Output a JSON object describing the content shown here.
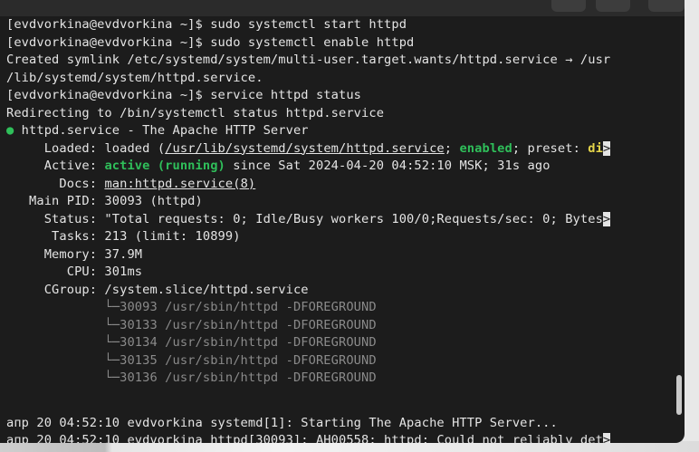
{
  "terminal": {
    "lines": [
      "[evdvorkina@evdvorkina ~]$ sudo systemctl start httpd",
      "[evdvorkina@evdvorkina ~]$ sudo systemctl enable httpd",
      "Created symlink /etc/systemd/system/multi-user.target.wants/httpd.service → /usr",
      "/lib/systemd/system/httpd.service.",
      "[evdvorkina@evdvorkina ~]$ service httpd status",
      "Redirecting to /bin/systemctl status httpd.service"
    ],
    "status": {
      "dot": "●",
      "unit_title": " httpd.service - The Apache HTTP Server",
      "loaded_label": "     Loaded: ",
      "loaded_pre": "loaded (",
      "loaded_path": "/usr/lib/systemd/system/httpd.service",
      "loaded_sep": "; ",
      "loaded_enabled": "enabled",
      "loaded_preset": "; preset: ",
      "loaded_preset_value": "di",
      "overflow_marker": ">",
      "active_label": "     Active: ",
      "active_value": "active (running)",
      "active_since": " since Sat 2024-04-20 04:52:10 MSK; 31s ago",
      "docs_label": "       Docs: ",
      "docs_value": "man:httpd.service(8)",
      "mainpid_line": "   Main PID: 30093 (httpd)",
      "status_line": "     Status: \"Total requests: 0; Idle/Busy workers 100/0;Requests/sec: 0; Bytes",
      "tasks_line": "      Tasks: 213 (limit: 10899)",
      "memory_line": "     Memory: 37.9M",
      "cpu_line": "        CPU: 301ms",
      "cgroup_line": "     CGroup: /system.slice/httpd.service",
      "cgroup_children": [
        "             └─30093 /usr/sbin/httpd -DFOREGROUND",
        "             └─30133 /usr/sbin/httpd -DFOREGROUND",
        "             └─30134 /usr/sbin/httpd -DFOREGROUND",
        "             └─30135 /usr/sbin/httpd -DFOREGROUND",
        "             └─30136 /usr/sbin/httpd -DFOREGROUND"
      ]
    },
    "log_lines": [
      "апр 20 04:52:10 evdvorkina systemd[1]: Starting The Apache HTTP Server...",
      "апр 20 04:52:10 evdvorkina httpd[30093]: AH00558: httpd: Could not reliably det"
    ]
  },
  "colors": {
    "background": "#1c1c1c",
    "text": "#e4e4e4",
    "accent_green": "#2fbf5a",
    "accent_yellow": "#e4d44a"
  }
}
